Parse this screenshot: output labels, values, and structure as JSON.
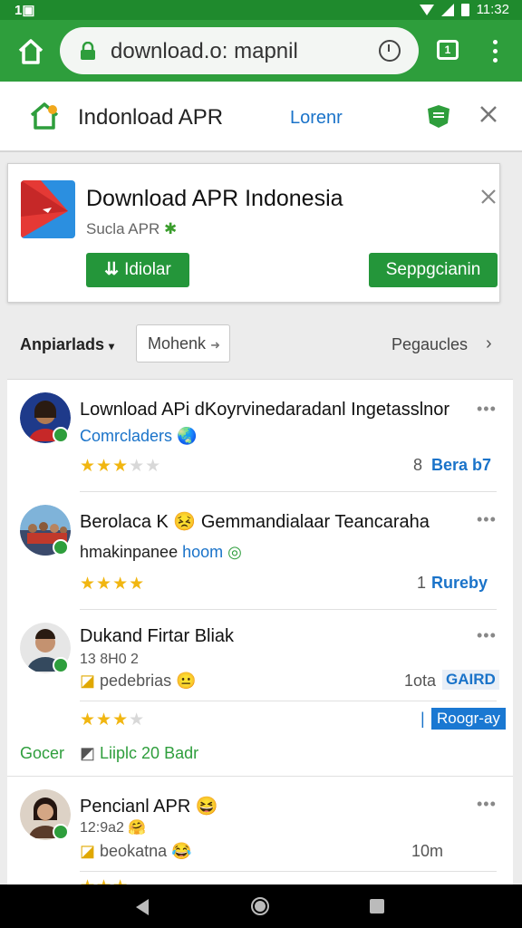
{
  "status_bar": {
    "left": "1▣",
    "time": "11:32"
  },
  "browser": {
    "url": "download.o: mapnil",
    "tabs_count": "1"
  },
  "page_header": {
    "title": "Indonload APR",
    "link": "Lorenr"
  },
  "download_card": {
    "title": "Download APR Indonesia",
    "subtitle": "Sucla APR",
    "install_label": "Idiolar",
    "secondary_label": "Seppgcianin"
  },
  "filter_bar": {
    "sort_label": "Anpiarlads",
    "filter_value": "Mohenk",
    "pages_label": "Pegaucles"
  },
  "items": [
    {
      "title": "Lownload APi dKoyrvinedaradanl Ingetasslnor",
      "subtitle": "Comrcladers",
      "stars": "★★★",
      "stars_off": "★★",
      "right_num": "8",
      "right_link": "Bera b7"
    },
    {
      "title": "Berolaca K",
      "title2": "Gemmandialaar Teancaraha",
      "subtitle": "hmakinpanee",
      "subtitle_link": "hoom",
      "stars": "★★★★",
      "right_num": "1",
      "right_link": "Rureby"
    },
    {
      "title": "Dukand Firtar Bliak",
      "meta": "13 8H0 2",
      "subtitle": "pedebrias",
      "stars": "★★★",
      "stars_off": "★",
      "right_num": "1ota",
      "badge": "GAIRD",
      "tag": "Roogr-ay",
      "footer_left": "Gocer",
      "footer_text": "Liiplc 20 Badr"
    },
    {
      "title": "Pencianl APR",
      "meta": "12:9a2",
      "subtitle": "beokatna",
      "right_num": "10m"
    }
  ]
}
